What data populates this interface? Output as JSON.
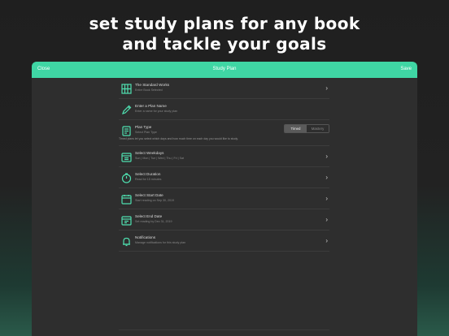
{
  "headline": {
    "line1": "set study plans for any book",
    "line2": "and tackle your goals"
  },
  "navbar": {
    "close_label": "Close",
    "title": "Study Plan",
    "save_label": "Save",
    "bg_color": "#3fd6a4"
  },
  "rows": [
    {
      "icon": "book-grid-icon",
      "title": "The Standard Works",
      "sub": "Entire Book Selected",
      "chevron": "›"
    },
    {
      "icon": "pencil-icon",
      "title": "Enter a Plan Name",
      "sub": "Enter a name for your study plan",
      "chevron": ""
    },
    {
      "icon": "plan-type-icon",
      "title": "Plan Type",
      "sub": "Select Plan Type",
      "chevron": ""
    },
    {
      "icon": "weekdays-icon",
      "title": "Select Weekdays",
      "sub": "Sun | Mon | Tue | Wed | Thu | Fri | Sat",
      "chevron": "›"
    },
    {
      "icon": "timer-icon",
      "title": "Select Duration",
      "sub": "Read for 15 minutes",
      "chevron": "›"
    },
    {
      "icon": "calendar-start-icon",
      "title": "Select Start Date",
      "sub": "Start reading on Sep 30, 2019",
      "chevron": "›"
    },
    {
      "icon": "calendar-end-icon",
      "title": "Select End Date",
      "sub": "Set reading by Dec 31, 2019",
      "chevron": "›"
    },
    {
      "icon": "bell-icon",
      "title": "Notifications",
      "sub": "Manage notifications for this study plan",
      "chevron": "›"
    }
  ],
  "plan_type": {
    "option_timed": "Timed",
    "option_mastery": "Mastery",
    "selected": "Timed",
    "note": "Timed plans let you select which days and how much time on each day you would like to study."
  },
  "accent_color": "#4fe0b0"
}
